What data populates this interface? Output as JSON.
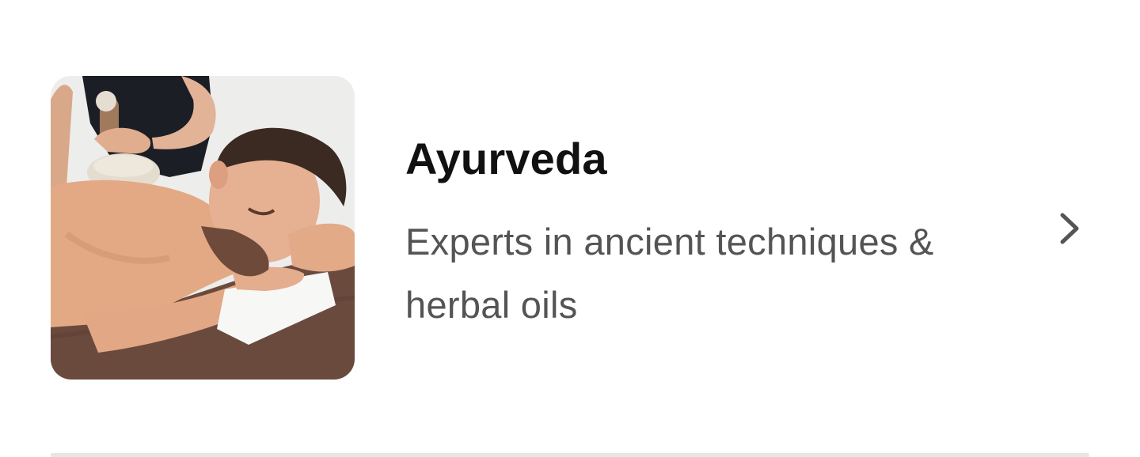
{
  "service_item": {
    "title": "Ayurveda",
    "description": "Experts in ancient techniques & herbal oils",
    "image_icon": "massage-photo",
    "chevron_icon": "chevron-right-icon"
  },
  "colors": {
    "title": "#111111",
    "description": "#545454",
    "chevron": "#555555",
    "divider": "#e6e6e6"
  }
}
